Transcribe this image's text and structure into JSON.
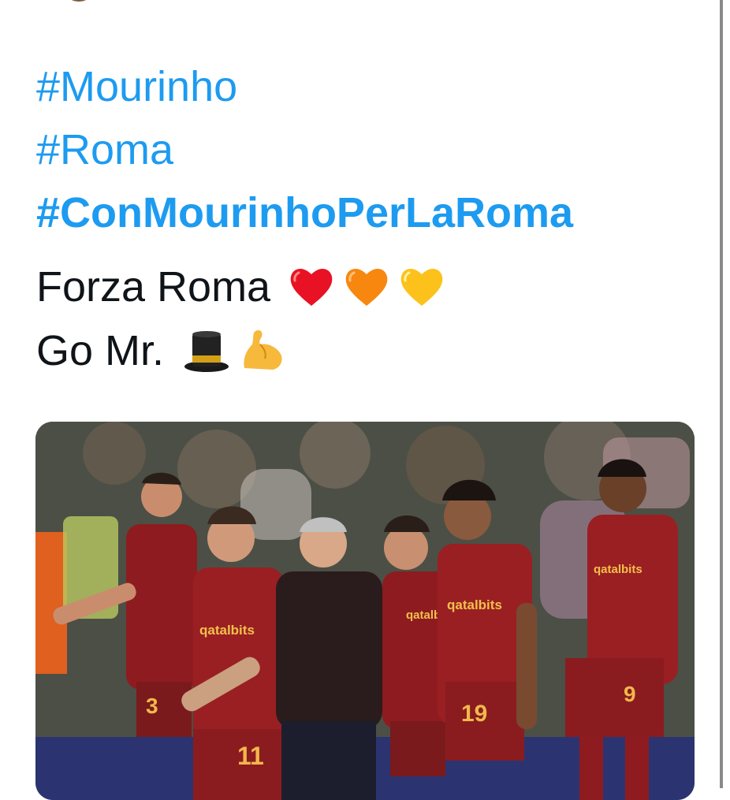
{
  "tweet": {
    "hashtags": [
      "#Mourinho",
      "#Roma",
      "#ConMourinhoPerLaRoma"
    ],
    "line1_text": "Forza Roma",
    "line2_text": "Go Mr.",
    "line1_emojis": [
      "red-heart",
      "orange-heart",
      "yellow-heart"
    ],
    "line2_emojis": [
      "top-hat",
      "flexed-biceps"
    ]
  },
  "photo": {
    "sponsor": "qatalbits",
    "shirt_numbers": [
      "3",
      "11",
      "19",
      "9"
    ]
  },
  "colors": {
    "hashtag": "#1d9bf0",
    "text": "#0f1419",
    "roma_red": "#8e1b1f"
  }
}
